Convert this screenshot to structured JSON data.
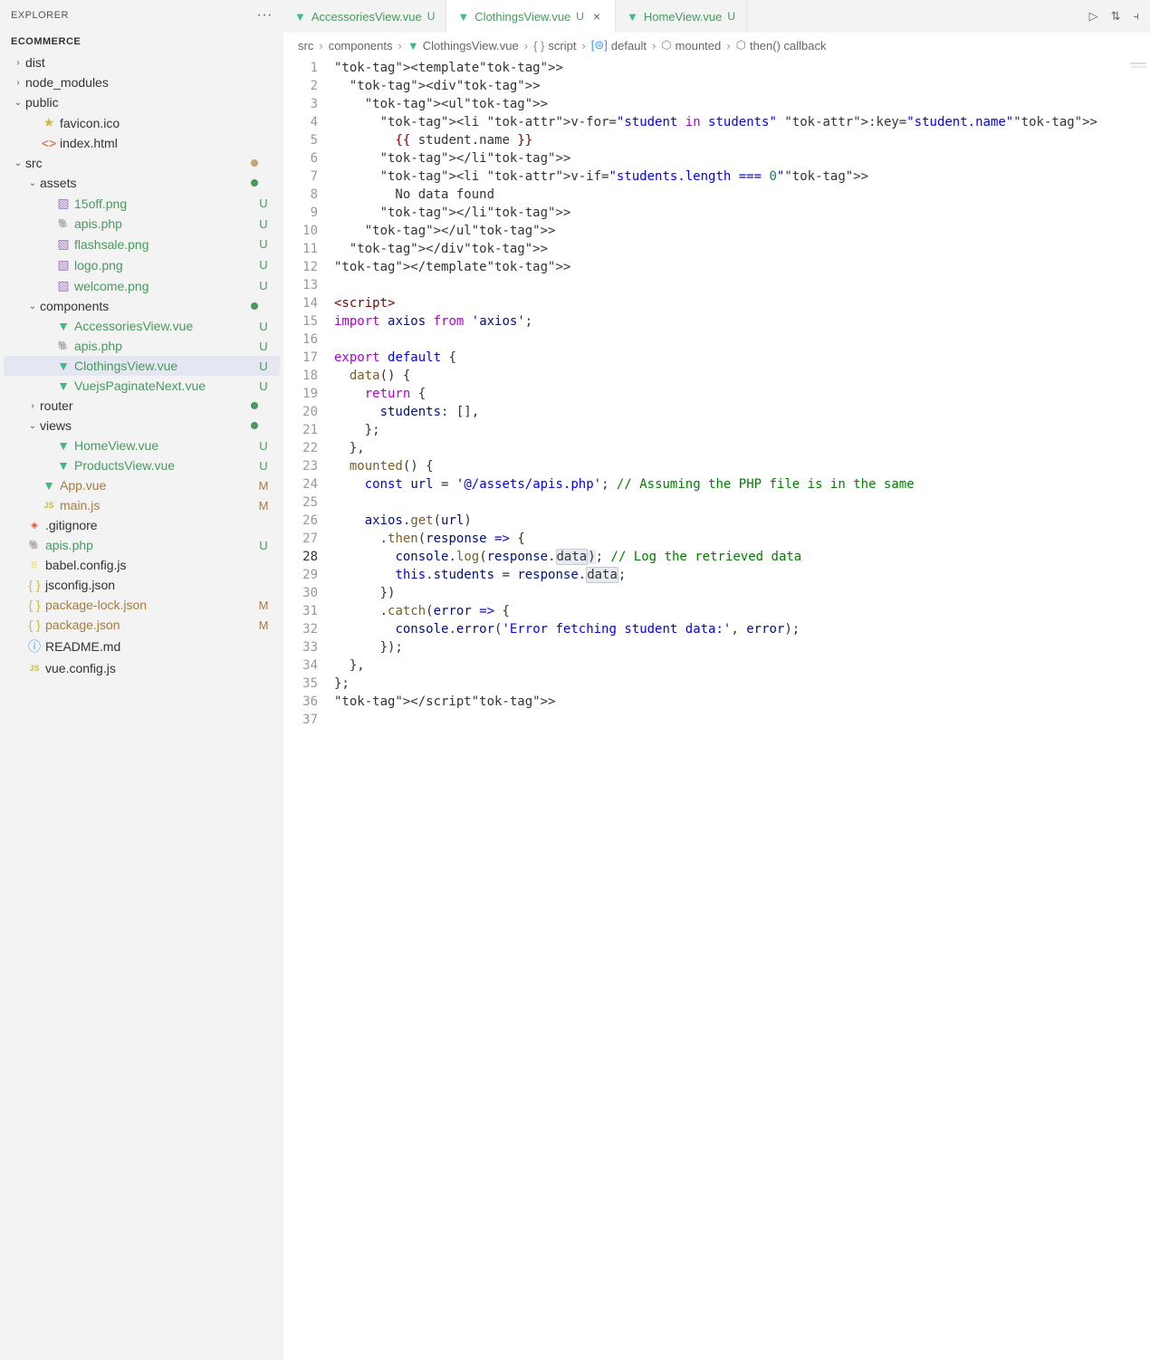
{
  "sidebar": {
    "title": "EXPLORER",
    "project": "ECOMMERCE",
    "tree": [
      {
        "label": "dist",
        "type": "folder",
        "collapsed": true,
        "indent": 0
      },
      {
        "label": "node_modules",
        "type": "folder",
        "collapsed": true,
        "indent": 0
      },
      {
        "label": "public",
        "type": "folder",
        "collapsed": false,
        "indent": 0
      },
      {
        "label": "favicon.ico",
        "type": "file",
        "icon": "star",
        "indent": 1
      },
      {
        "label": "index.html",
        "type": "file",
        "icon": "html",
        "indent": 1
      },
      {
        "label": "src",
        "type": "folder",
        "collapsed": false,
        "indent": 0,
        "dot": "tan"
      },
      {
        "label": "assets",
        "type": "folder",
        "collapsed": false,
        "indent": 1,
        "dot": "green"
      },
      {
        "label": "15off.png",
        "type": "file",
        "icon": "img",
        "indent": 2,
        "status": "U"
      },
      {
        "label": "apis.php",
        "type": "file",
        "icon": "php",
        "indent": 2,
        "status": "U"
      },
      {
        "label": "flashsale.png",
        "type": "file",
        "icon": "img",
        "indent": 2,
        "status": "U"
      },
      {
        "label": "logo.png",
        "type": "file",
        "icon": "img",
        "indent": 2,
        "status": "U"
      },
      {
        "label": "welcome.png",
        "type": "file",
        "icon": "img",
        "indent": 2,
        "status": "U"
      },
      {
        "label": "components",
        "type": "folder",
        "collapsed": false,
        "indent": 1,
        "dot": "green"
      },
      {
        "label": "AccessoriesView.vue",
        "type": "file",
        "icon": "vue",
        "indent": 2,
        "status": "U"
      },
      {
        "label": "apis.php",
        "type": "file",
        "icon": "php",
        "indent": 2,
        "status": "U"
      },
      {
        "label": "ClothingsView.vue",
        "type": "file",
        "icon": "vue",
        "indent": 2,
        "status": "U",
        "selected": true
      },
      {
        "label": "VuejsPaginateNext.vue",
        "type": "file",
        "icon": "vue",
        "indent": 2,
        "status": "U"
      },
      {
        "label": "router",
        "type": "folder",
        "collapsed": true,
        "indent": 1,
        "dot": "green"
      },
      {
        "label": "views",
        "type": "folder",
        "collapsed": false,
        "indent": 1,
        "dot": "green"
      },
      {
        "label": "HomeView.vue",
        "type": "file",
        "icon": "vue",
        "indent": 2,
        "status": "U"
      },
      {
        "label": "ProductsView.vue",
        "type": "file",
        "icon": "vue",
        "indent": 2,
        "status": "U"
      },
      {
        "label": "App.vue",
        "type": "file",
        "icon": "vue",
        "indent": 1,
        "status": "M"
      },
      {
        "label": "main.js",
        "type": "file",
        "icon": "js",
        "indent": 1,
        "status": "M"
      },
      {
        "label": ".gitignore",
        "type": "file",
        "icon": "git",
        "indent": 0
      },
      {
        "label": "apis.php",
        "type": "file",
        "icon": "php",
        "indent": 0,
        "status": "U"
      },
      {
        "label": "babel.config.js",
        "type": "file",
        "icon": "babel",
        "indent": 0
      },
      {
        "label": "jsconfig.json",
        "type": "file",
        "icon": "json",
        "indent": 0
      },
      {
        "label": "package-lock.json",
        "type": "file",
        "icon": "json",
        "indent": 0,
        "status": "M"
      },
      {
        "label": "package.json",
        "type": "file",
        "icon": "json",
        "indent": 0,
        "status": "M"
      },
      {
        "label": "README.md",
        "type": "file",
        "icon": "info",
        "indent": 0
      },
      {
        "label": "vue.config.js",
        "type": "file",
        "icon": "js",
        "indent": 0
      }
    ]
  },
  "tabs": [
    {
      "label": "AccessoriesView.vue",
      "status": "U",
      "active": false
    },
    {
      "label": "ClothingsView.vue",
      "status": "U",
      "active": true,
      "close": true
    },
    {
      "label": "HomeView.vue",
      "status": "U",
      "active": false
    }
  ],
  "breadcrumbs": [
    {
      "label": "src"
    },
    {
      "label": "components"
    },
    {
      "label": "ClothingsView.vue",
      "icon": "vue"
    },
    {
      "label": "script",
      "icon": "bracket"
    },
    {
      "label": "default",
      "icon": "eq"
    },
    {
      "label": "mounted",
      "icon": "cube"
    },
    {
      "label": "then() callback",
      "icon": "cube"
    }
  ],
  "editor": {
    "active_line": 28,
    "breakpoint_line": 23,
    "lines": [
      "<template>",
      "  <div>",
      "    <ul>",
      "      <li v-for=\"student in students\" :key=\"student.name\">",
      "        {{ student.name }}",
      "      </li>",
      "      <li v-if=\"students.length === 0\">",
      "        No data found",
      "      </li>",
      "    </ul>",
      "  </div>",
      "</template>",
      "",
      "<script>",
      "import axios from 'axios';",
      "",
      "export default {",
      "  data() {",
      "    return {",
      "      students: [],",
      "    };",
      "  },",
      "  mounted() {",
      "    const url = '@/assets/apis.php'; // Assuming the PHP file is in the same",
      "",
      "    axios.get(url)",
      "      .then(response => {",
      "        console.log(response.data); // Log the retrieved data",
      "        this.students = response.data;",
      "      })",
      "      .catch(error => {",
      "        console.error('Error fetching student data:', error);",
      "      });",
      "  },",
      "};",
      "</script>",
      ""
    ]
  }
}
